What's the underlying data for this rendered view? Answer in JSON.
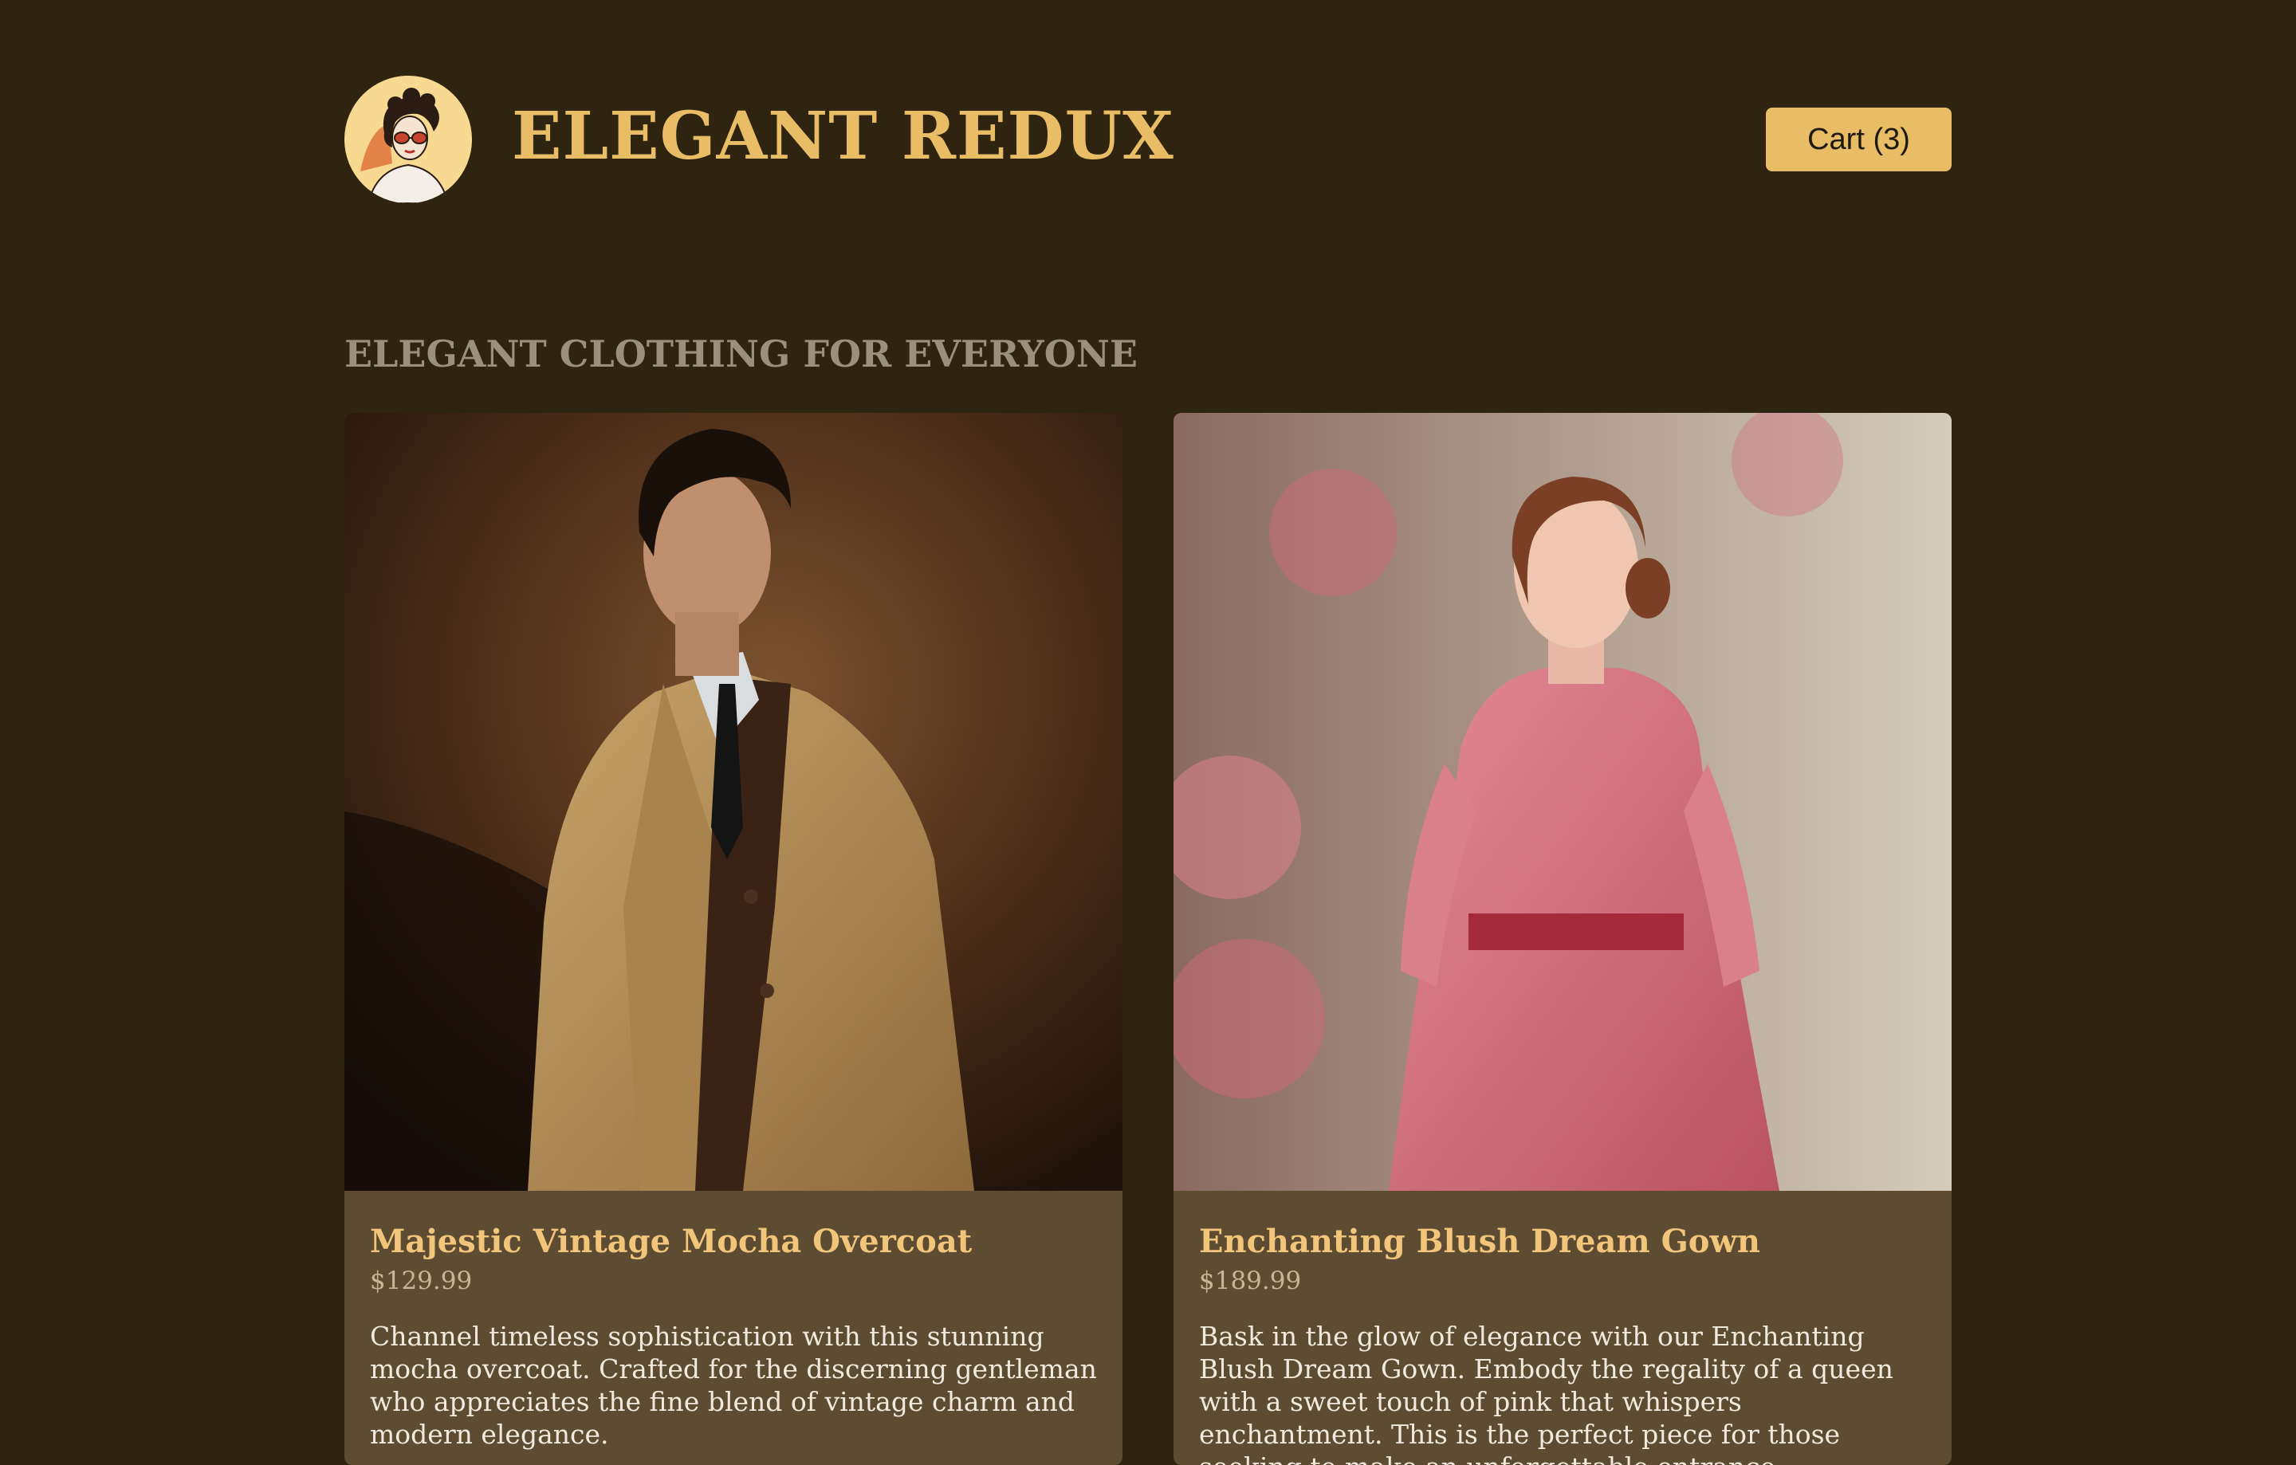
{
  "header": {
    "brand": "ELEGANT REDUX",
    "logo_icon": "vintage-woman-portrait-logo",
    "cart_label": "Cart (3)"
  },
  "main": {
    "section_title": "ELEGANT CLOTHING FOR EVERYONE",
    "products": [
      {
        "name": "Majestic Vintage Mocha Overcoat",
        "price": "$129.99",
        "description": "Channel timeless sophistication with this stunning mocha overcoat. Crafted for the discerning gentleman who appreciates the fine blend of vintage charm and modern elegance.",
        "image": "man-in-mocha-overcoat-photo"
      },
      {
        "name": "Enchanting Blush Dream Gown",
        "price": "$189.99",
        "description": "Bask in the glow of elegance with our Enchanting Blush Dream Gown. Embody the regality of a queen with a sweet touch of pink that whispers enchantment. This is the perfect piece for those seeking to make an unforgettable entrance.",
        "image": "woman-in-pink-gown-photo"
      }
    ]
  },
  "colors": {
    "background": "#2f2410",
    "accent": "#e9bc66",
    "card": "#5d4c32",
    "muted_heading": "#9c8f7c"
  }
}
